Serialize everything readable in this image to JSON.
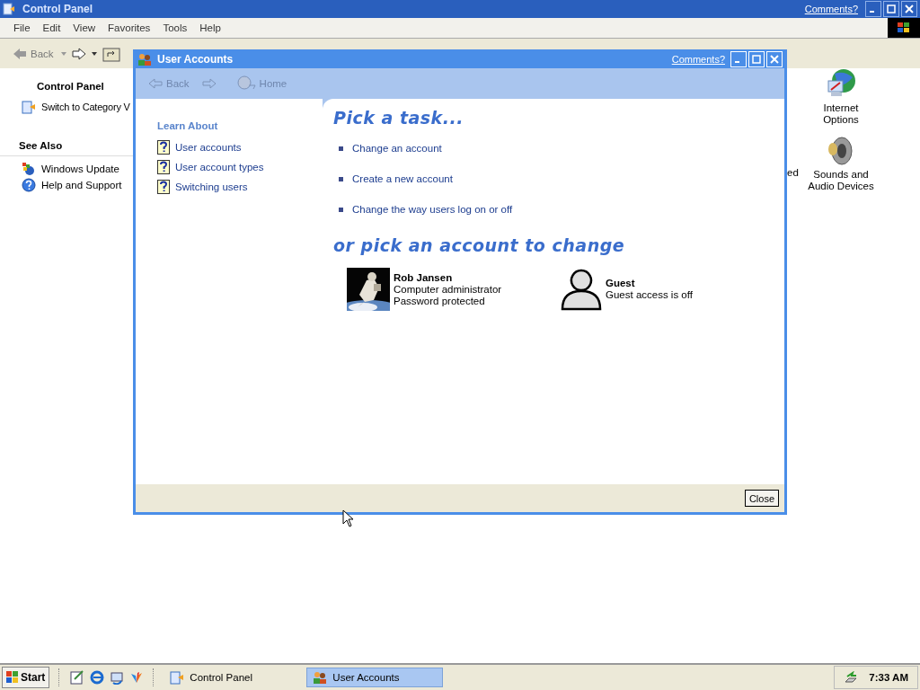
{
  "main_window": {
    "title": "Control Panel",
    "comments_link": "Comments?",
    "menu": [
      "File",
      "Edit",
      "View",
      "Favorites",
      "Tools",
      "Help"
    ],
    "toolbar": {
      "back": "Back"
    },
    "sidebar": {
      "title": "Control Panel",
      "switch_link": "Switch to Category V",
      "see_also_title": "See Also",
      "see_also": [
        "Windows Update",
        "Help and Support"
      ]
    },
    "partial_label": "ed",
    "icons": [
      {
        "label": "Internet Options"
      },
      {
        "label": "Sounds and Audio Devices"
      }
    ]
  },
  "dialog": {
    "title": "User Accounts",
    "comments_link": "Comments?",
    "nav": {
      "back": "Back",
      "home": "Home"
    },
    "learn_about": {
      "title": "Learn About",
      "items": [
        "User accounts",
        "User account types",
        "Switching users"
      ]
    },
    "task_heading": "Pick a task...",
    "tasks": [
      "Change an account",
      "Create a new account",
      "Change the way users log on or off"
    ],
    "account_heading": "or pick an account to change",
    "accounts": [
      {
        "name": "Rob Jansen",
        "details": [
          "Computer administrator",
          "Password protected"
        ]
      },
      {
        "kind": "silhouette",
        "name": "Guest",
        "details": [
          "Guest access is off"
        ]
      }
    ],
    "close_button": "Close"
  },
  "taskbar": {
    "start": "Start",
    "tasks": [
      {
        "label": "Control Panel",
        "selected": false
      },
      {
        "label": "User Accounts",
        "selected": true
      }
    ],
    "clock": "7:33 AM"
  }
}
